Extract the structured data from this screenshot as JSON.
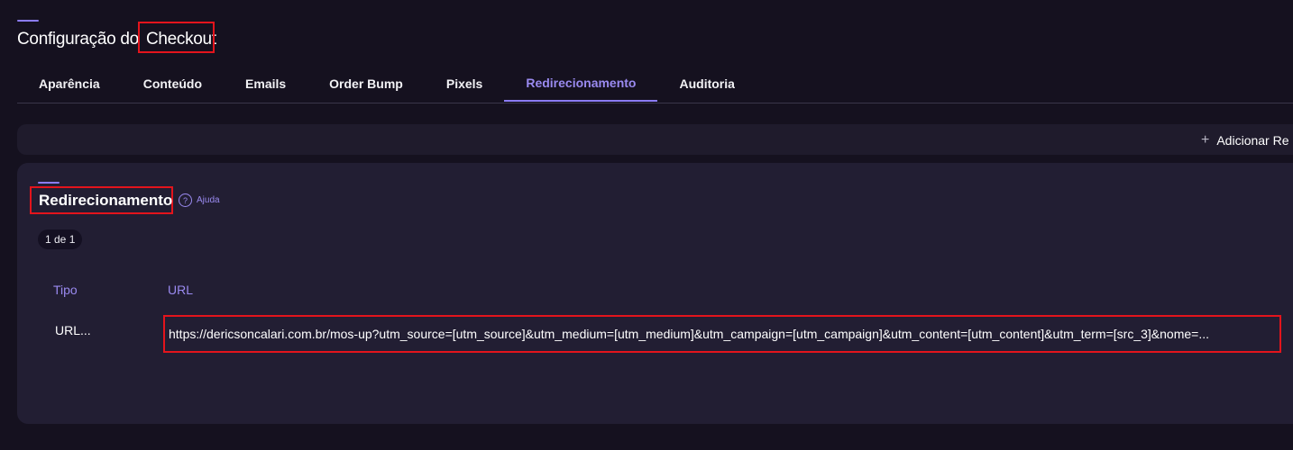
{
  "page": {
    "title_prefix": "Configuração do",
    "title_highlight": "Checkout"
  },
  "tabs": [
    {
      "label": "Aparência",
      "active": false
    },
    {
      "label": "Conteúdo",
      "active": false
    },
    {
      "label": "Emails",
      "active": false
    },
    {
      "label": "Order Bump",
      "active": false
    },
    {
      "label": "Pixels",
      "active": false
    },
    {
      "label": "Redirecionamento",
      "active": true
    },
    {
      "label": "Auditoria",
      "active": false
    }
  ],
  "toolbar": {
    "add_icon": "plus-icon",
    "add_label": "Adicionar Re"
  },
  "section": {
    "title": "Redirecionamento",
    "help_icon": "question-circle-icon",
    "help_label": "Ajuda",
    "pager": "1 de 1"
  },
  "table": {
    "columns": [
      "Tipo",
      "URL"
    ],
    "rows": [
      {
        "type": "URL...",
        "url": "https://dericsoncalari.com.br/mos-up?utm_source=[utm_source]&utm_medium=[utm_medium]&utm_campaign=[utm_campaign]&utm_content=[utm_content]&utm_term=[src_3]&nome=..."
      }
    ]
  },
  "colors": {
    "background": "#15111f",
    "card": "#221e33",
    "accent": "#8b7cf6",
    "highlight_outline": "#e3141c"
  }
}
